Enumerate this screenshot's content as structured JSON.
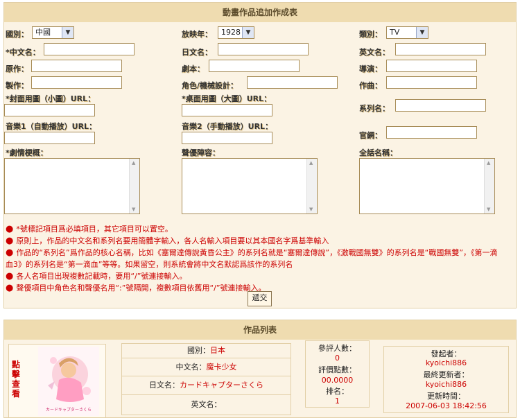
{
  "form": {
    "title": "動畫作品追加作成表",
    "country_label": "國別：",
    "country_value": "中國",
    "year_label": "放映年：",
    "year_value": "1928",
    "type_label": "類別：",
    "type_value": "TV",
    "cn_name_label": "*中文名：",
    "jp_name_label": "日文名：",
    "en_name_label": "英文名：",
    "original_label": "原作：",
    "script_label": "劇本：",
    "director_label": "導演：",
    "production_label": "製作：",
    "char_design_label": "角色/機械設計：",
    "music_label": "作曲：",
    "cover_small_label": "*封面用圖（小圖）URL：",
    "cover_large_label": "*桌面用圖（大圖）URL：",
    "series_label": "系列名：",
    "music1_label": "音樂1（自動播放）URL：",
    "music2_label": "音樂2（手動播放）URL：",
    "official_label": "官網：",
    "synopsis_label": "*劇情梗概：",
    "voice_label": "聲優陣容：",
    "episodes_label": "全話名稱：",
    "submit_label": "遞交"
  },
  "notes": [
    "*號標記項目爲必填項目，其它項目可以置空。",
    "原則上，作品的中文名和系列名要用簡體字輸入，各人名輸入項目要以其本國名字爲基準輸入",
    "作品的“系列名”爲作品的核心名稱，比如《塞爾達傳說黃昏公主》的系列名就是“塞爾達傳說”，《激戰國無雙》的系列名是“戰國無雙”，《第一滴血3》的系列名是“第一滴血”等等。如果留空，則系統會將中文名默認爲該作的系列名",
    "各人名項目出現複數記載時，要用“/”號連接輸入。",
    "聲優項目中角色名和聲優名用“:”號隔開，複數項目依舊用“/”號連接輸入。"
  ],
  "works": {
    "title": "作品列表",
    "view_label": "點擊查看",
    "country_label": "國別：",
    "country_value": "日本",
    "cn_name_label": "中文名：",
    "cn_name_value": "魔卡少女",
    "jp_name_label": "日文名：",
    "jp_name_value": "カードキャプターさくら",
    "en_name_label": "英文名：",
    "en_name_value": "",
    "raters_label": "參評人數：",
    "raters_value": "0",
    "score_label": "評價點數：",
    "score_value": "00.0000",
    "rank_label": "排名：",
    "rank_value": "1",
    "creator_label": "發起者：",
    "creator_value": "kyoichi886",
    "updater_label": "最終更新者：",
    "updater_value": "kyoichi886",
    "updated_label": "更新時間：",
    "updated_value": "2007-06-03 18:42:56",
    "thumb_caption": "カードキャプターさくら"
  },
  "colors": {
    "header": "#efdcb0",
    "panel": "#fbf3e4",
    "border": "#e2cfa6",
    "note": "#cc0000",
    "input_border": "#a78c57"
  }
}
